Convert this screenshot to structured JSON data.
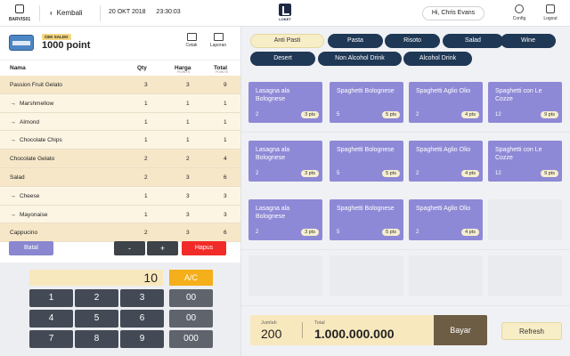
{
  "topbar": {
    "cashier_label": "BARVIS01",
    "back_label": "Kembali",
    "date": "20 OKT 2018",
    "time": "23:30:03",
    "logo_text": "LOKET",
    "user_greeting": "Hi, Chris Evans",
    "config_label": "Config",
    "logout_label": "Logout"
  },
  "account": {
    "saldo_label": "CEK SALDO",
    "points": "1000 point",
    "print_label": "Cetak",
    "report_label": "Laporan"
  },
  "table": {
    "headers": {
      "name": "Nama",
      "qty": "Qty",
      "price": "Harga",
      "price_unit": "POINTS",
      "total": "Total",
      "total_unit": "POINTS"
    },
    "rows": [
      {
        "name": "Passion Fruit Gelato",
        "qty": "3",
        "price": "3",
        "total": "9",
        "child": false
      },
      {
        "name": "Marshmellow",
        "qty": "1",
        "price": "1",
        "total": "1",
        "child": true
      },
      {
        "name": "Almond",
        "qty": "1",
        "price": "1",
        "total": "1",
        "child": true
      },
      {
        "name": "Chocolate Chips",
        "qty": "1",
        "price": "1",
        "total": "1",
        "child": true
      },
      {
        "name": "Chocolate Gelato",
        "qty": "2",
        "price": "2",
        "total": "4",
        "child": false
      },
      {
        "name": "Salad",
        "qty": "2",
        "price": "3",
        "total": "6",
        "child": false
      },
      {
        "name": "Cheese",
        "qty": "1",
        "price": "3",
        "total": "3",
        "child": true
      },
      {
        "name": "Mayonaise",
        "qty": "1",
        "price": "3",
        "total": "3",
        "child": true
      },
      {
        "name": "Cappucino",
        "qty": "2",
        "price": "3",
        "total": "6",
        "child": false
      }
    ]
  },
  "controls": {
    "cancel": "Batal",
    "minus": "-",
    "plus": "+",
    "delete": "Hapus"
  },
  "keypad": {
    "display": "10",
    "clear": "A/C",
    "keys": [
      "1",
      "2",
      "3",
      "00",
      "4",
      "5",
      "6",
      "00",
      "7",
      "8",
      "9",
      "000"
    ]
  },
  "categories": [
    "Anti Pasti",
    "Pasta",
    "Risoto",
    "Salad",
    "Wine",
    "Desert",
    "Non Alcohol Drink",
    "Alcohol Drink"
  ],
  "active_category": "Anti Pasti",
  "menu_items": [
    {
      "name": "Lasagna ala Bolognese",
      "count": "2",
      "pts": "3 pts"
    },
    {
      "name": "Spaghetti Bolognese",
      "count": "5",
      "pts": "5 pts"
    },
    {
      "name": "Spaghetti Aglio Olio",
      "count": "2",
      "pts": "4 pts"
    },
    {
      "name": "Spaghetti con Le Cozze",
      "count": "12",
      "pts": "9 pts"
    },
    {
      "name": "Lasagna ala Bolognese",
      "count": "2",
      "pts": "3 pts"
    },
    {
      "name": "Spaghetti Bolognese",
      "count": "5",
      "pts": "5 pts"
    },
    {
      "name": "Spaghetti Aglio Olio",
      "count": "2",
      "pts": "4 pts"
    },
    {
      "name": "Spaghetti con Le Cozze",
      "count": "12",
      "pts": "9 pts"
    },
    {
      "name": "Lasagna ala Bolognese",
      "count": "2",
      "pts": "3 pts"
    },
    {
      "name": "Spaghetti Bolognese",
      "count": "5",
      "pts": "5 pts"
    },
    {
      "name": "Spaghetti Aglio Olio",
      "count": "2",
      "pts": "4 pts"
    }
  ],
  "summary": {
    "qty_label": "Jumlah",
    "qty_value": "200",
    "total_label": "Total",
    "total_value": "1.000.000.000",
    "pay_label": "Bayar",
    "refresh_label": "Refresh"
  },
  "colors": {
    "category_bg": "#1f3856",
    "item_bg": "#8e89d6",
    "delete_bg": "#f12c28",
    "ac_bg": "#f4af1a",
    "pay_bg": "#6e5d45"
  }
}
